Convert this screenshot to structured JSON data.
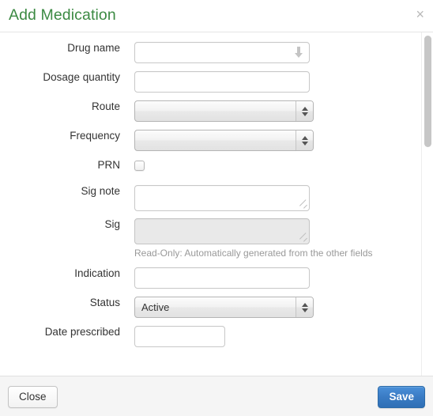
{
  "modal": {
    "title": "Add Medication",
    "close_icon_label": "×"
  },
  "form": {
    "fields": [
      {
        "label": "Drug name",
        "type": "typeahead",
        "value": "",
        "placeholder": ""
      },
      {
        "label": "Dosage quantity",
        "type": "text",
        "value": "",
        "placeholder": ""
      },
      {
        "label": "Route",
        "type": "select",
        "value": ""
      },
      {
        "label": "Frequency",
        "type": "select",
        "value": ""
      },
      {
        "label": "PRN",
        "type": "checkbox",
        "checked": false
      },
      {
        "label": "Sig note",
        "type": "textarea",
        "value": ""
      },
      {
        "label": "Sig",
        "type": "textarea-readonly",
        "value": "",
        "help": "Read-Only: Automatically generated from the other fields"
      },
      {
        "label": "Indication",
        "type": "text",
        "value": "",
        "placeholder": ""
      },
      {
        "label": "Status",
        "type": "select",
        "value": "Active"
      },
      {
        "label": "Date prescribed",
        "type": "text-short",
        "value": "",
        "placeholder": ""
      }
    ]
  },
  "footer": {
    "close_label": "Close",
    "save_label": "Save"
  },
  "colors": {
    "title_green": "#3c8a43",
    "save_blue": "#3a7bc4",
    "help_grey": "#999999",
    "footer_bg": "#f5f5f5"
  }
}
